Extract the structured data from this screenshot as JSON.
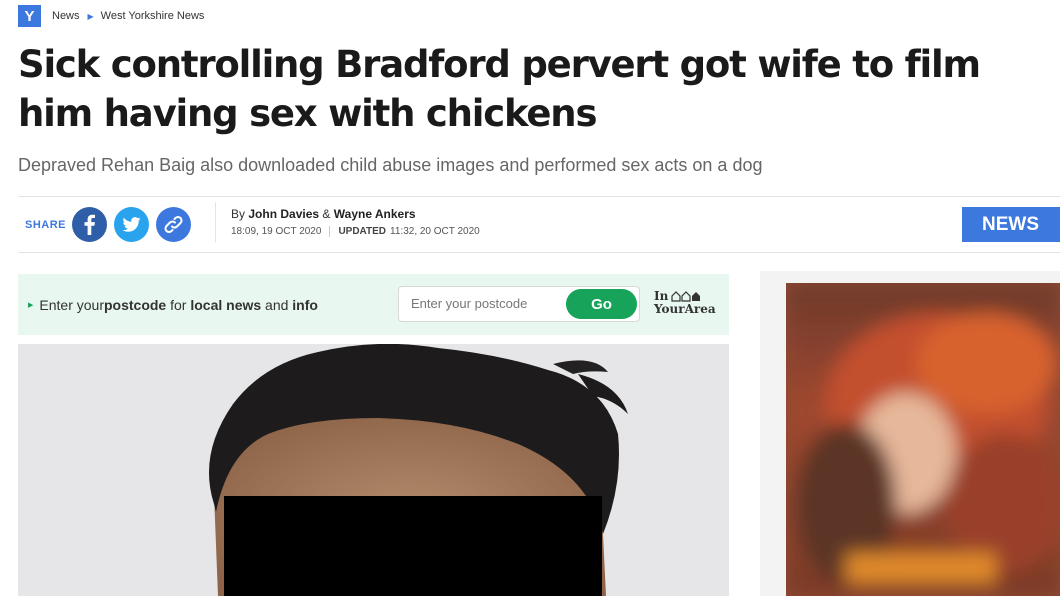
{
  "breadcrumb": {
    "logo": "Y",
    "items": [
      "News",
      "West Yorkshire News"
    ]
  },
  "article": {
    "headline": "Sick controlling Bradford pervert got wife to film him having sex with chickens",
    "subheadline": "Depraved Rehan Baig also downloaded child abuse images and performed sex acts on a dog",
    "byline_prefix": "By",
    "author1": "John Davies",
    "author_sep": "&",
    "author2": "Wayne Ankers",
    "published": "18:09, 19 OCT 2020",
    "updated_label": "UPDATED",
    "updated": "11:32, 20 OCT 2020",
    "section_badge": "NEWS"
  },
  "share": {
    "label": "SHARE",
    "buttons": [
      "facebook-icon",
      "twitter-icon",
      "link-icon"
    ]
  },
  "postcode": {
    "text_1": "Enter your ",
    "text_bold_1": "postcode",
    "text_2": " for ",
    "text_bold_2": "local news",
    "text_3": " and ",
    "text_bold_3": "info",
    "placeholder": "Enter your postcode",
    "button": "Go",
    "brand_line1": "In",
    "brand_line2": "YourArea"
  },
  "colors": {
    "accent": "#3d78de",
    "go_green": "#17a35a",
    "postcode_bg": "#e8f7f0"
  }
}
